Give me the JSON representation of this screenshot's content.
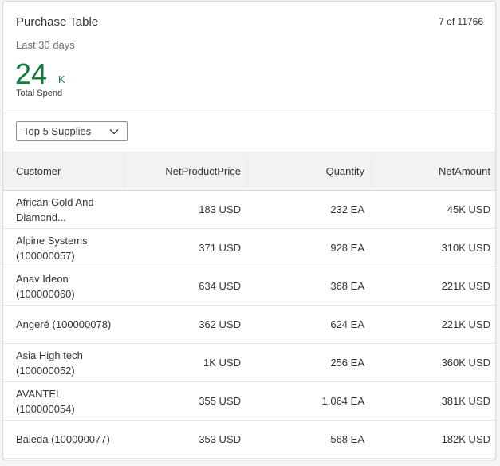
{
  "card": {
    "title": "Purchase Table",
    "counter": "7 of 11766",
    "subtitle": "Last 30 days",
    "kpi": {
      "value": "24",
      "unit": "K",
      "label": "Total Spend"
    }
  },
  "filter": {
    "selected": "Top 5 Supplies"
  },
  "table": {
    "columns": [
      "Customer",
      "NetProductPrice",
      "Quantity",
      "NetAmount"
    ],
    "rows": [
      {
        "customer": "African Gold And Diamond...",
        "price": "183 USD",
        "quantity": "232 EA",
        "amount": "45K USD"
      },
      {
        "customer": "Alpine Systems (100000057)",
        "price": "371 USD",
        "quantity": "928 EA",
        "amount": "310K USD"
      },
      {
        "customer": "Anav Ideon (100000060)",
        "price": "634 USD",
        "quantity": "368 EA",
        "amount": "221K USD"
      },
      {
        "customer": "Angeré (100000078)",
        "price": "362 USD",
        "quantity": "624 EA",
        "amount": "221K USD"
      },
      {
        "customer": "Asia High tech (100000052)",
        "price": "1K USD",
        "quantity": "256 EA",
        "amount": "360K USD"
      },
      {
        "customer": "AVANTEL (100000054)",
        "price": "355 USD",
        "quantity": "1,064 EA",
        "amount": "381K USD"
      },
      {
        "customer": "Baleda (100000077)",
        "price": "353 USD",
        "quantity": "568 EA",
        "amount": "182K USD"
      }
    ]
  },
  "colors": {
    "kpi": "#107e3e",
    "header_bg": "#f2f2f2",
    "text": "#32363a"
  },
  "icons": {
    "select_arrow": "chevron-down-icon"
  }
}
